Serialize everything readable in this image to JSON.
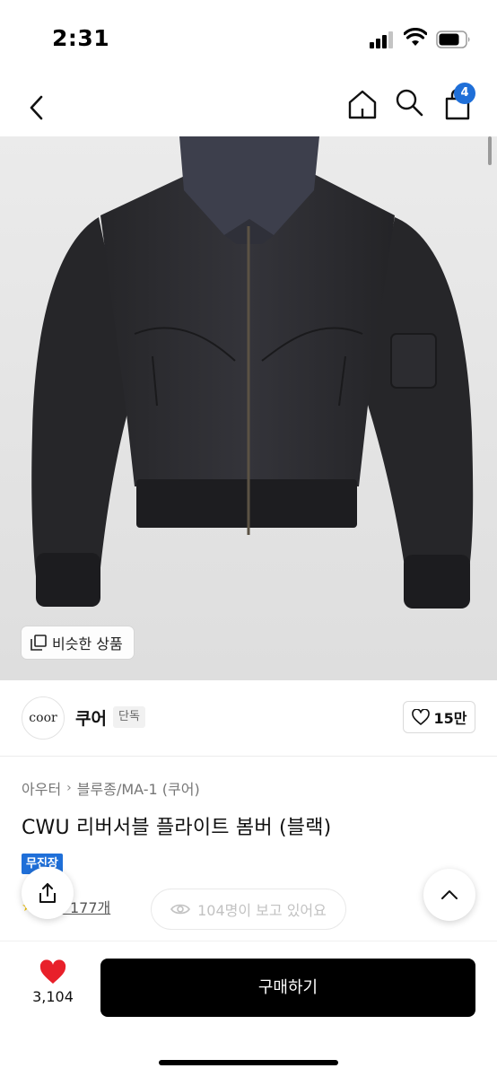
{
  "status_bar": {
    "time": "2:31"
  },
  "nav": {
    "cart_count": "4",
    "icons": [
      "chevron-left-icon",
      "home-icon",
      "search-icon",
      "shopping-bag-icon"
    ]
  },
  "hero": {
    "similar_label": "비슷한 상품",
    "background_color": "#e6e6e6"
  },
  "brand": {
    "logo_text": "coor",
    "name": "쿠어",
    "tag": "단독",
    "likes": "15만"
  },
  "product": {
    "breadcrumb": [
      "아우터",
      "블루종/MA-1 (쿠어)"
    ],
    "title": "CWU 리버서블 플라이트 봄버 (블랙)",
    "shipping_badge": "무진장",
    "reviews": "후기 177개",
    "viewers": "104명이 보고 있어요"
  },
  "bottom_bar": {
    "wish_count": "3,104",
    "buy_label": "구매하기",
    "accent_heart": "#e8202a"
  },
  "colors": {
    "accent_blue": "#1f6fd8",
    "buy_button": "#000000"
  }
}
